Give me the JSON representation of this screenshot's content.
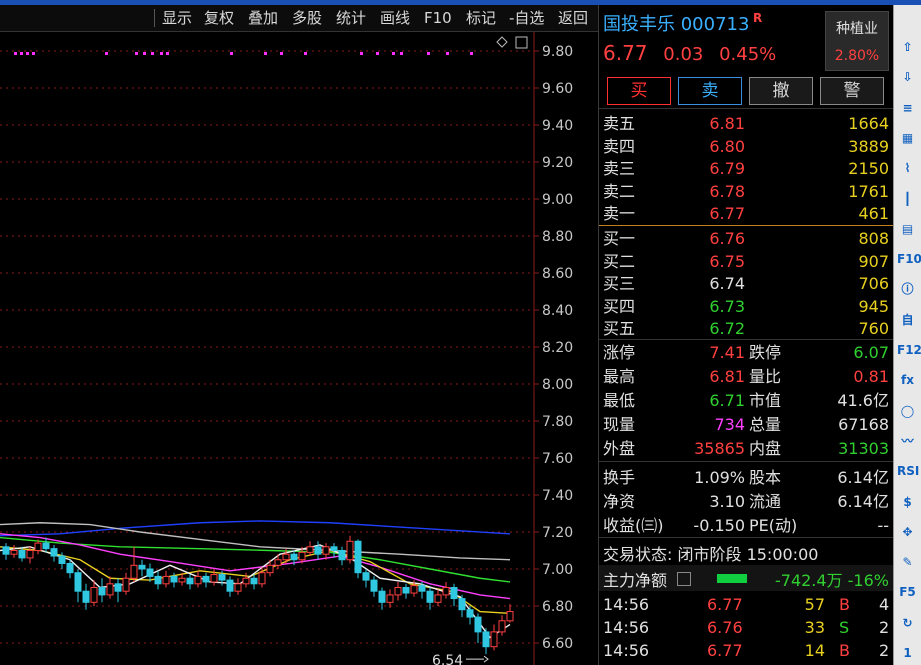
{
  "toolbar": {
    "items": [
      "显示",
      "复权",
      "叠加",
      "多股",
      "统计",
      "画线",
      "F10",
      "标记",
      "-自选",
      "返回"
    ]
  },
  "chart": {
    "y_ticks": [
      "9.80",
      "9.60",
      "9.40",
      "9.20",
      "9.00",
      "8.80",
      "8.60",
      "8.40",
      "8.20",
      "8.00",
      "7.80",
      "7.60",
      "7.40",
      "7.20",
      "7.00",
      "6.80",
      "6.60"
    ],
    "low_marker": "6.54",
    "colors": {
      "up": "#ff4040",
      "down": "#30c8e0",
      "ma5": "#f0f0f0",
      "ma10": "#e8d020",
      "ma20": "#ff40ff",
      "ma30": "#30e030",
      "ma60": "#2040ff",
      "ma120": "#c0c0c0",
      "grid": "#8a1a1a"
    }
  },
  "quote": {
    "name": "国投丰乐",
    "code": "000713",
    "flag": "R",
    "sector": "种植业",
    "sector_pct": "2.80%",
    "price": "6.77",
    "change": "0.03",
    "change_pct": "0.45%"
  },
  "actions": {
    "buy": "买",
    "sell": "卖",
    "cancel": "撤",
    "alert": "警"
  },
  "asks": [
    {
      "label": "卖五",
      "price": "6.81",
      "vol": "1664",
      "color": "red"
    },
    {
      "label": "卖四",
      "price": "6.80",
      "vol": "3889",
      "color": "red"
    },
    {
      "label": "卖三",
      "price": "6.79",
      "vol": "2150",
      "color": "red"
    },
    {
      "label": "卖二",
      "price": "6.78",
      "vol": "1761",
      "color": "red"
    },
    {
      "label": "卖一",
      "price": "6.77",
      "vol": "461",
      "color": "red"
    }
  ],
  "bids": [
    {
      "label": "买一",
      "price": "6.76",
      "vol": "808",
      "color": "red"
    },
    {
      "label": "买二",
      "price": "6.75",
      "vol": "907",
      "color": "red"
    },
    {
      "label": "买三",
      "price": "6.74",
      "vol": "706",
      "color": "white"
    },
    {
      "label": "买四",
      "price": "6.73",
      "vol": "945",
      "color": "green"
    },
    {
      "label": "买五",
      "price": "6.72",
      "vol": "760",
      "color": "green"
    }
  ],
  "stats": {
    "limit_up_label": "涨停",
    "limit_up": "7.41",
    "limit_down_label": "跌停",
    "limit_down": "6.07",
    "high_label": "最高",
    "high": "6.81",
    "vol_ratio_label": "量比",
    "vol_ratio": "0.81",
    "low_label": "最低",
    "low": "6.71",
    "mcap_label": "市值",
    "mcap": "41.6亿",
    "cur_vol_label": "现量",
    "cur_vol": "734",
    "total_vol_label": "总量",
    "total_vol": "67168",
    "outer_label": "外盘",
    "outer": "35865",
    "inner_label": "内盘",
    "inner": "31303",
    "turnover_label": "换手",
    "turnover": "1.09%",
    "shares_label": "股本",
    "shares": "6.14亿",
    "nav_label": "净资",
    "nav": "3.10",
    "float_label": "流通",
    "float": "6.14亿",
    "eps_label": "收益(㈢)",
    "eps": "-0.150",
    "pe_label": "PE(动)",
    "pe": "--"
  },
  "status": "交易状态: 闭市阶段 15:00:00",
  "mainflow": {
    "label": "主力净额",
    "value": "-742.4万 -16%"
  },
  "ticks": [
    {
      "time": "14:56",
      "price": "6.77",
      "qty": "57",
      "dir": "B",
      "n": "4"
    },
    {
      "time": "14:56",
      "price": "6.76",
      "qty": "33",
      "dir": "S",
      "n": "2"
    },
    {
      "time": "14:56",
      "price": "6.77",
      "qty": "14",
      "dir": "B",
      "n": "2"
    }
  ],
  "side_icons": [
    "up-arrow-icon",
    "down-arrow-icon",
    "list-icon",
    "grid-icon",
    "line-chart-icon",
    "candle-icon",
    "doc-icon",
    "f10-icon",
    "info-icon",
    "self-icon",
    "f12-icon",
    "fx-icon",
    "circle-icon",
    "wave-icon",
    "rsi-icon",
    "dollar-icon",
    "move-icon",
    "pencil-icon",
    "f5-icon",
    "refresh-icon",
    "one-icon"
  ],
  "side_labels": {
    "f10": "F10",
    "f12": "F12",
    "rsi": "RSI",
    "f5": "F5",
    "one": "1",
    "fx": "fx",
    "self": "自",
    "dollar": "$"
  }
}
